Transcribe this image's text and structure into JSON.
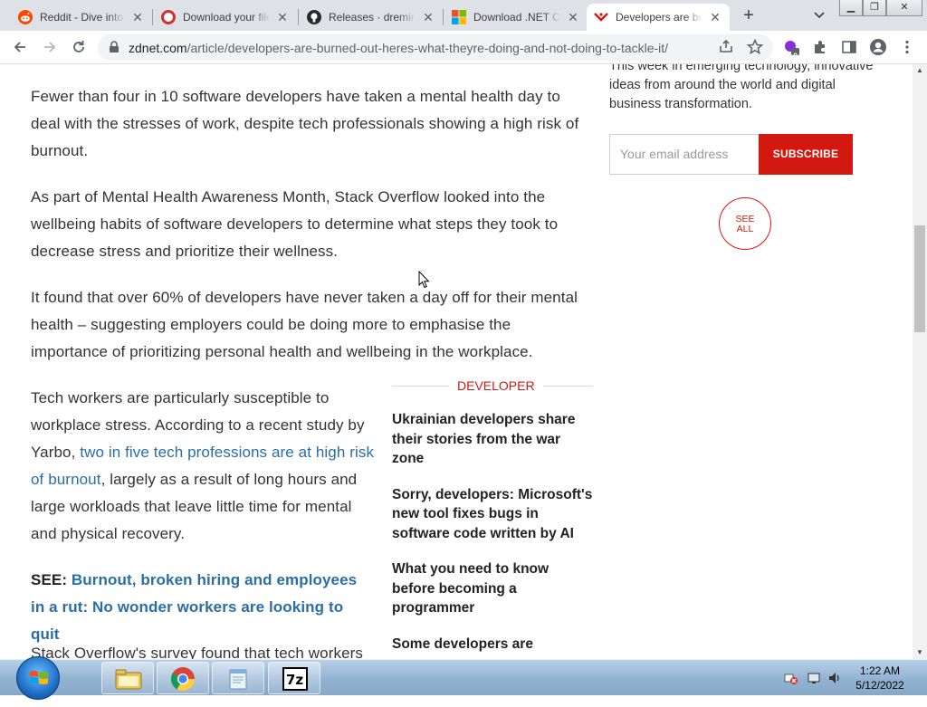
{
  "tabs": [
    {
      "title": "Reddit - Dive into anything",
      "icon": "reddit-icon"
    },
    {
      "title": "Download your files",
      "icon": "download-site-icon"
    },
    {
      "title": "Releases · dreming",
      "icon": "github-icon"
    },
    {
      "title": "Download .NET Core",
      "icon": "microsoft-icon"
    },
    {
      "title": "Developers are burned out",
      "icon": "zdnet-icon"
    }
  ],
  "address": {
    "domain": "zdnet.com",
    "path": "/article/developers-are-burned-out-heres-what-theyre-doing-and-not-doing-to-tackle-it/"
  },
  "extensions_badge": "0",
  "article": {
    "p1": "Fewer than four in 10 software developers have taken a mental health day to deal with the stresses of work, despite tech professionals showing a high risk of burnout.",
    "p2": "As part of Mental Health Awareness Month, Stack Overflow looked into the wellbeing habits of software developers to determine what steps they took to decrease stress and prioritize their wellness.",
    "p3": "It found that over 60% of developers have never taken a day off for their mental health – suggesting employers could be doing more to emphasise the importance of prioritizing personal health and wellbeing in the workplace.",
    "p4_before": "Tech workers are particularly susceptible to workplace stress. According to a recent study by Yarbo, ",
    "p4_link": "two in five tech professions are at high risk of burnout",
    "p4_after": ", largely as a result of long hours and large workloads that leave little time for mental and physical recovery.",
    "see_label": "SEE",
    "see_colon": ": ",
    "see_link": "Burnout, broken hiring and employees in a rut: No wonder workers are looking to quit",
    "p6": "Stack Overflow's survey found that tech workers"
  },
  "sidebar": {
    "newsletter_text": "This week in emerging technology, innovative ideas from around the world and digital business transformation.",
    "email_placeholder": "Your email address",
    "subscribe_label": "SUBSCRIBE",
    "see_all_line1": "SEE",
    "see_all_line2": "ALL"
  },
  "related": {
    "category": "DEVELOPER",
    "items": [
      "Ukrainian developers share their stories from the war zone",
      "Sorry, developers: Microsoft's new tool fixes bugs in software code written by AI",
      "What you need to know before becoming a programmer",
      "Some developers are"
    ]
  },
  "taskbar": {
    "time": "1:22 AM",
    "date": "5/12/2022",
    "apps": [
      "explorer-icon",
      "chrome-icon",
      "notepad-icon",
      "7zip-icon"
    ]
  }
}
